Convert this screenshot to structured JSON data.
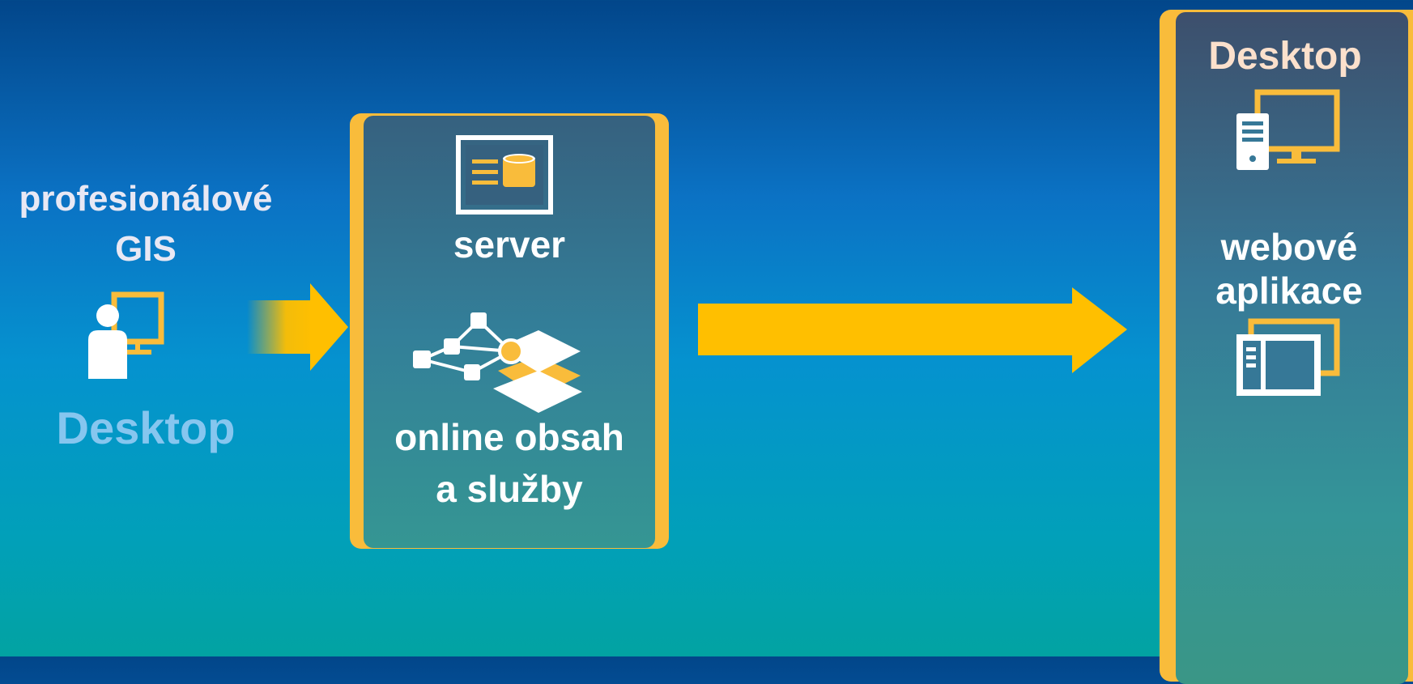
{
  "left": {
    "title_line1": "profesionálové",
    "title_line2": "GIS",
    "label": "Desktop"
  },
  "middle_panel": {
    "server_label": "server",
    "content_line1": "online obsah",
    "content_line2": "a služby"
  },
  "right_panel": {
    "desktop_label": "Desktop",
    "web_line1": "webové",
    "web_line2": "aplikace"
  },
  "colors": {
    "accent": "#f9bc3b",
    "arrow": "#ffbf00",
    "bg_top": "#02468a",
    "bg_bottom": "#02a3a2"
  },
  "icons": [
    "user-at-desktop-icon",
    "server-icon",
    "network-layers-icon",
    "desktop-computer-icon",
    "web-app-icon"
  ]
}
